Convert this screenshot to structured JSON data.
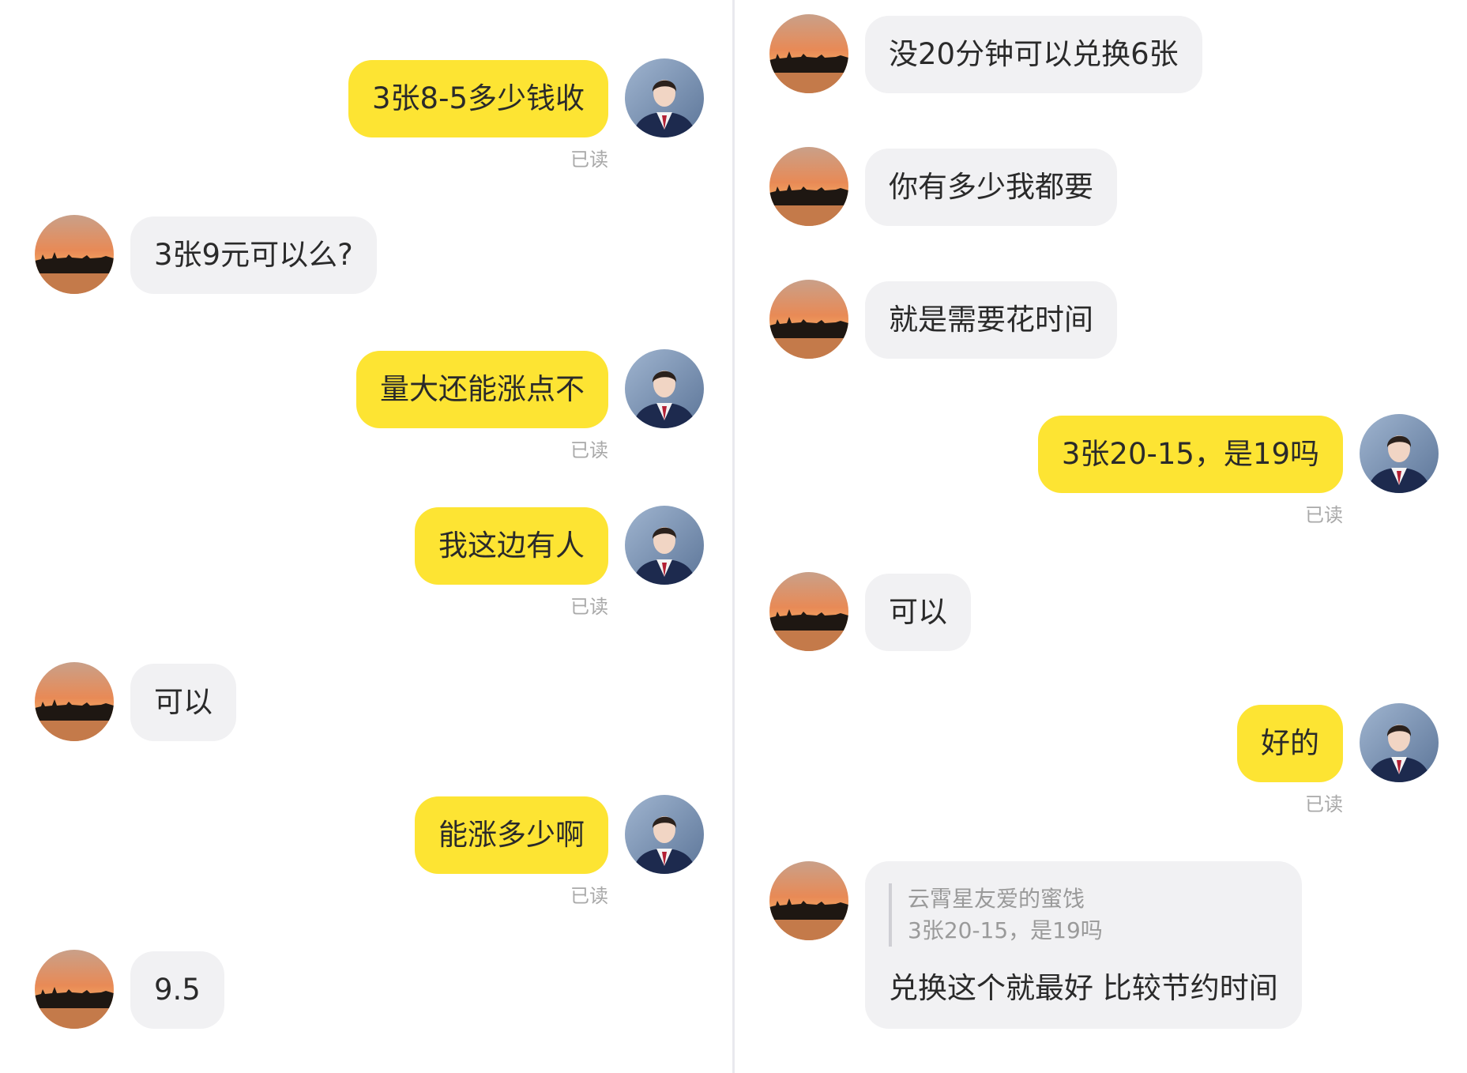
{
  "read_label": "已读",
  "left": {
    "messages": [
      {
        "dir": "out",
        "text": "3张8-5多少钱收"
      },
      {
        "dir": "in",
        "text": "3张9元可以么?"
      },
      {
        "dir": "out",
        "text": "量大还能涨点不"
      },
      {
        "dir": "out",
        "text": "我这边有人"
      },
      {
        "dir": "in",
        "text": "可以"
      },
      {
        "dir": "out",
        "text": "能涨多少啊"
      },
      {
        "dir": "in",
        "text": "9.5"
      }
    ]
  },
  "right": {
    "messages": [
      {
        "dir": "in",
        "text": "没20分钟可以兑换6张"
      },
      {
        "dir": "in",
        "text": "你有多少我都要"
      },
      {
        "dir": "in",
        "text": "就是需要花时间"
      },
      {
        "dir": "out",
        "text": "3张20-15，是19吗"
      },
      {
        "dir": "in",
        "text": "可以"
      },
      {
        "dir": "out",
        "text": "好的"
      }
    ],
    "quoted_message": {
      "quoted_author": "云霄星友爱的蜜饯",
      "quoted_text": "3张20-15，是19吗",
      "text": "兑换这个就最好  比较节约时间"
    }
  },
  "colors": {
    "outgoing_bubble": "#fde433",
    "incoming_bubble": "#f1f1f3",
    "read_text": "#a9a9a9"
  }
}
